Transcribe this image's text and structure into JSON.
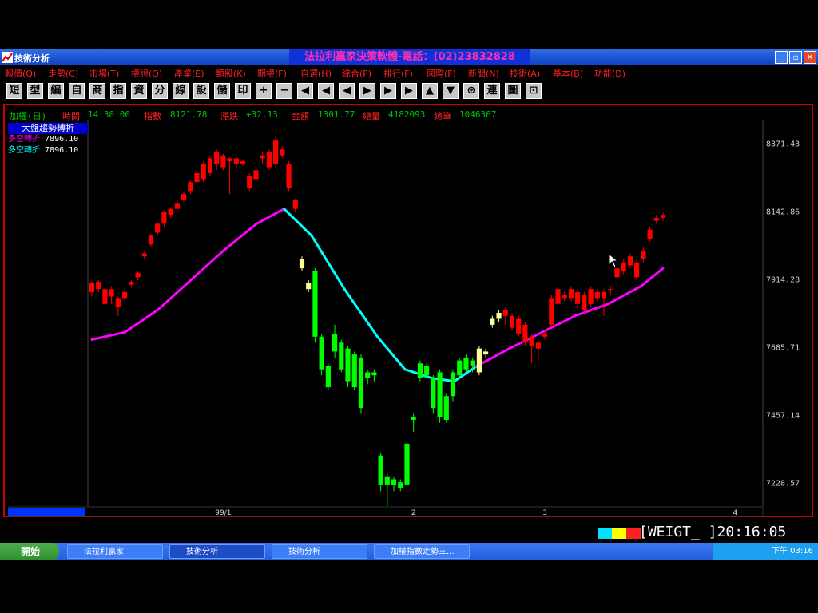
{
  "window": {
    "title": "技術分析",
    "banner": "法拉利贏家決策軟體-電話：(02)23832828"
  },
  "menu": [
    "報價(Q)",
    "走勢(C)",
    "市場(T)",
    "權證(Q)",
    "產業(E)",
    "類股(K)",
    "期權(F)",
    "自選(H)",
    "綜合(F)",
    "排行(F)",
    "國際(F)",
    "新聞(N)",
    "技術(A)",
    "基本(B)",
    "功能(D)"
  ],
  "toolbar": [
    "短",
    "型",
    "編",
    "自",
    "商",
    "指",
    "資",
    "分",
    "線",
    "設",
    "儲",
    "印",
    "+",
    "−",
    "◀",
    "◀",
    "◀",
    "▶",
    "▶",
    "▶",
    "▲",
    "▼",
    "⊕",
    "連",
    "圖",
    "⊡"
  ],
  "info": {
    "symbol": "加權(日)",
    "time_label": "時間",
    "time_value": "14:30:00",
    "index_label": "指數",
    "index_value": "8121.78",
    "change_label": "漲跌",
    "change_value": "+32.13",
    "amount_label": "金額",
    "amount_value": "1301.77",
    "volume_label": "總量",
    "volume_value": "4182093",
    "trades_label": "總筆",
    "trades_value": "1046367"
  },
  "legend": {
    "title": "大盤趨勢轉折",
    "rows": [
      {
        "name": "多空轉折",
        "value": "7896.10",
        "color": "#ff00ff"
      },
      {
        "name": "多空轉折",
        "value": "7896.10",
        "color": "#00ffff"
      }
    ]
  },
  "chart_data": {
    "type": "candlestick",
    "y_ticks": [
      8371.43,
      8142.86,
      7914.28,
      7685.71,
      7457.14,
      7228.57
    ],
    "y_tick_labels": [
      "8371.43",
      "8142.86",
      "7914.28",
      "7685.71",
      "7457.14",
      "7228.57"
    ],
    "ylim": [
      7150,
      8450
    ],
    "x_labels": [
      {
        "label": "99/1",
        "index": 20
      },
      {
        "label": "2",
        "index": 49
      },
      {
        "label": "3",
        "index": 69
      },
      {
        "label": "4",
        "index": 98
      }
    ],
    "colors": {
      "up": "#ff0000",
      "down": "#00ff00",
      "neutral": "#ffff99",
      "ma_up": "#ff00ff",
      "ma_down": "#00ffff"
    },
    "candles": [
      [
        7870,
        7900,
        7855,
        7905,
        "r"
      ],
      [
        7880,
        7905,
        7870,
        7910,
        "r"
      ],
      [
        7830,
        7880,
        7820,
        7885,
        "r"
      ],
      [
        7855,
        7880,
        7830,
        7890,
        "r"
      ],
      [
        7820,
        7850,
        7790,
        7855,
        "r"
      ],
      [
        7850,
        7870,
        7840,
        7880,
        "r"
      ],
      [
        7895,
        7905,
        7885,
        7910,
        "r"
      ],
      [
        7920,
        7935,
        7910,
        7940,
        "r"
      ],
      [
        7990,
        8000,
        7980,
        8005,
        "r"
      ],
      [
        8030,
        8060,
        8020,
        8065,
        "r"
      ],
      [
        8070,
        8100,
        8060,
        8105,
        "r"
      ],
      [
        8100,
        8140,
        8090,
        8145,
        "r"
      ],
      [
        8130,
        8150,
        8120,
        8155,
        "r"
      ],
      [
        8150,
        8170,
        8145,
        8180,
        "r"
      ],
      [
        8180,
        8200,
        8175,
        8210,
        "r"
      ],
      [
        8210,
        8240,
        8200,
        8245,
        "r"
      ],
      [
        8240,
        8270,
        8230,
        8275,
        "r"
      ],
      [
        8250,
        8300,
        8240,
        8310,
        "r"
      ],
      [
        8270,
        8320,
        8260,
        8330,
        "r"
      ],
      [
        8300,
        8340,
        8280,
        8350,
        "r"
      ],
      [
        8290,
        8330,
        8280,
        8335,
        "r"
      ],
      [
        8310,
        8320,
        8200,
        8325,
        "r"
      ],
      [
        8300,
        8320,
        8290,
        8330,
        "r"
      ],
      [
        8300,
        8310,
        8295,
        8315,
        "r"
      ],
      [
        8220,
        8260,
        8210,
        8270,
        "r"
      ],
      [
        8250,
        8280,
        8240,
        8290,
        "r"
      ],
      [
        8320,
        8330,
        8300,
        8340,
        "r"
      ],
      [
        8290,
        8340,
        8280,
        8350,
        "r"
      ],
      [
        8300,
        8380,
        8290,
        8390,
        "r"
      ],
      [
        8330,
        8350,
        8320,
        8360,
        "r"
      ],
      [
        8220,
        8300,
        8210,
        8310,
        "r"
      ],
      [
        8150,
        8180,
        8140,
        8185,
        "r"
      ],
      [
        7950,
        7980,
        7940,
        7990,
        "y"
      ],
      [
        7880,
        7900,
        7870,
        7910,
        "y"
      ],
      [
        7720,
        7940,
        7700,
        7950,
        "g"
      ],
      [
        7610,
        7720,
        7590,
        7730,
        "g"
      ],
      [
        7550,
        7620,
        7540,
        7630,
        "g"
      ],
      [
        7670,
        7730,
        7650,
        7760,
        "g"
      ],
      [
        7610,
        7700,
        7600,
        7710,
        "g"
      ],
      [
        7570,
        7680,
        7550,
        7690,
        "g"
      ],
      [
        7550,
        7660,
        7540,
        7670,
        "g"
      ],
      [
        7480,
        7650,
        7460,
        7660,
        "g"
      ],
      [
        7580,
        7600,
        7560,
        7610,
        "g"
      ],
      [
        7590,
        7600,
        7570,
        7610,
        "g"
      ],
      [
        7220,
        7320,
        7200,
        7330,
        "g"
      ],
      [
        7220,
        7250,
        7150,
        7260,
        "g"
      ],
      [
        7220,
        7240,
        7200,
        7250,
        "g"
      ],
      [
        7210,
        7230,
        7200,
        7240,
        "g"
      ],
      [
        7220,
        7360,
        7210,
        7370,
        "g"
      ],
      [
        7440,
        7450,
        7400,
        7460,
        "g"
      ],
      [
        7580,
        7630,
        7570,
        7640,
        "g"
      ],
      [
        7590,
        7620,
        7580,
        7630,
        "g"
      ],
      [
        7480,
        7580,
        7460,
        7590,
        "g"
      ],
      [
        7450,
        7600,
        7430,
        7610,
        "g"
      ],
      [
        7440,
        7520,
        7430,
        7530,
        "g"
      ],
      [
        7520,
        7600,
        7500,
        7610,
        "g"
      ],
      [
        7590,
        7640,
        7580,
        7650,
        "g"
      ],
      [
        7610,
        7650,
        7600,
        7660,
        "g"
      ],
      [
        7620,
        7640,
        7600,
        7650,
        "g"
      ],
      [
        7600,
        7680,
        7590,
        7690,
        "y"
      ],
      [
        7660,
        7670,
        7650,
        7680,
        "y"
      ],
      [
        7760,
        7780,
        7750,
        7790,
        "y"
      ],
      [
        7780,
        7800,
        7770,
        7810,
        "y"
      ],
      [
        7790,
        7810,
        7760,
        7820,
        "r"
      ],
      [
        7750,
        7790,
        7740,
        7800,
        "r"
      ],
      [
        7730,
        7780,
        7720,
        7790,
        "r"
      ],
      [
        7700,
        7760,
        7690,
        7770,
        "r"
      ],
      [
        7690,
        7720,
        7630,
        7730,
        "r"
      ],
      [
        7680,
        7700,
        7640,
        7710,
        "r"
      ],
      [
        7720,
        7730,
        7710,
        7740,
        "r"
      ],
      [
        7760,
        7850,
        7750,
        7860,
        "r"
      ],
      [
        7830,
        7880,
        7820,
        7890,
        "r"
      ],
      [
        7850,
        7860,
        7840,
        7870,
        "r"
      ],
      [
        7850,
        7880,
        7840,
        7890,
        "r"
      ],
      [
        7830,
        7870,
        7810,
        7880,
        "r"
      ],
      [
        7810,
        7860,
        7800,
        7870,
        "r"
      ],
      [
        7830,
        7880,
        7820,
        7890,
        "r"
      ],
      [
        7850,
        7870,
        7840,
        7880,
        "r"
      ],
      [
        7850,
        7870,
        7790,
        7880,
        "r"
      ],
      [
        7880,
        7880,
        7860,
        7890,
        "r"
      ],
      [
        7920,
        7950,
        7910,
        7960,
        "r"
      ],
      [
        7940,
        7970,
        7930,
        7980,
        "r"
      ],
      [
        7960,
        7990,
        7950,
        8000,
        "r"
      ],
      [
        7920,
        7970,
        7910,
        7980,
        "r"
      ],
      [
        7980,
        8010,
        7970,
        8020,
        "r"
      ],
      [
        8050,
        8080,
        8040,
        8090,
        "r"
      ],
      [
        8110,
        8120,
        8100,
        8130,
        "r"
      ],
      [
        8120,
        8130,
        8110,
        8140,
        "r"
      ]
    ],
    "ma": [
      [
        0,
        7710
      ],
      [
        6,
        7735
      ],
      [
        12,
        7810
      ],
      [
        18,
        7910
      ],
      [
        24,
        8010
      ],
      [
        30,
        8100
      ],
      [
        35,
        8150
      ],
      [
        40,
        8060
      ],
      [
        46,
        7880
      ],
      [
        52,
        7720
      ],
      [
        57,
        7610
      ],
      [
        62,
        7580
      ],
      [
        66,
        7570
      ],
      [
        70,
        7620
      ],
      [
        76,
        7680
      ],
      [
        82,
        7735
      ],
      [
        88,
        7790
      ],
      [
        94,
        7830
      ],
      [
        100,
        7890
      ],
      [
        104,
        7950
      ]
    ],
    "ma_turn_index": 35,
    "ma_up_again_index": 70
  },
  "status": {
    "symbol": "[WEIGT_ ]",
    "clock": "20:16:05",
    "colors": [
      "#00e0ff",
      "#ffff00",
      "#ff2020"
    ]
  },
  "taskbar": {
    "start": "開始",
    "items": [
      "法拉利贏家",
      "技術分析",
      "技術分析",
      "加權指數走勢三..."
    ],
    "tray_time": "下午 03:16"
  }
}
